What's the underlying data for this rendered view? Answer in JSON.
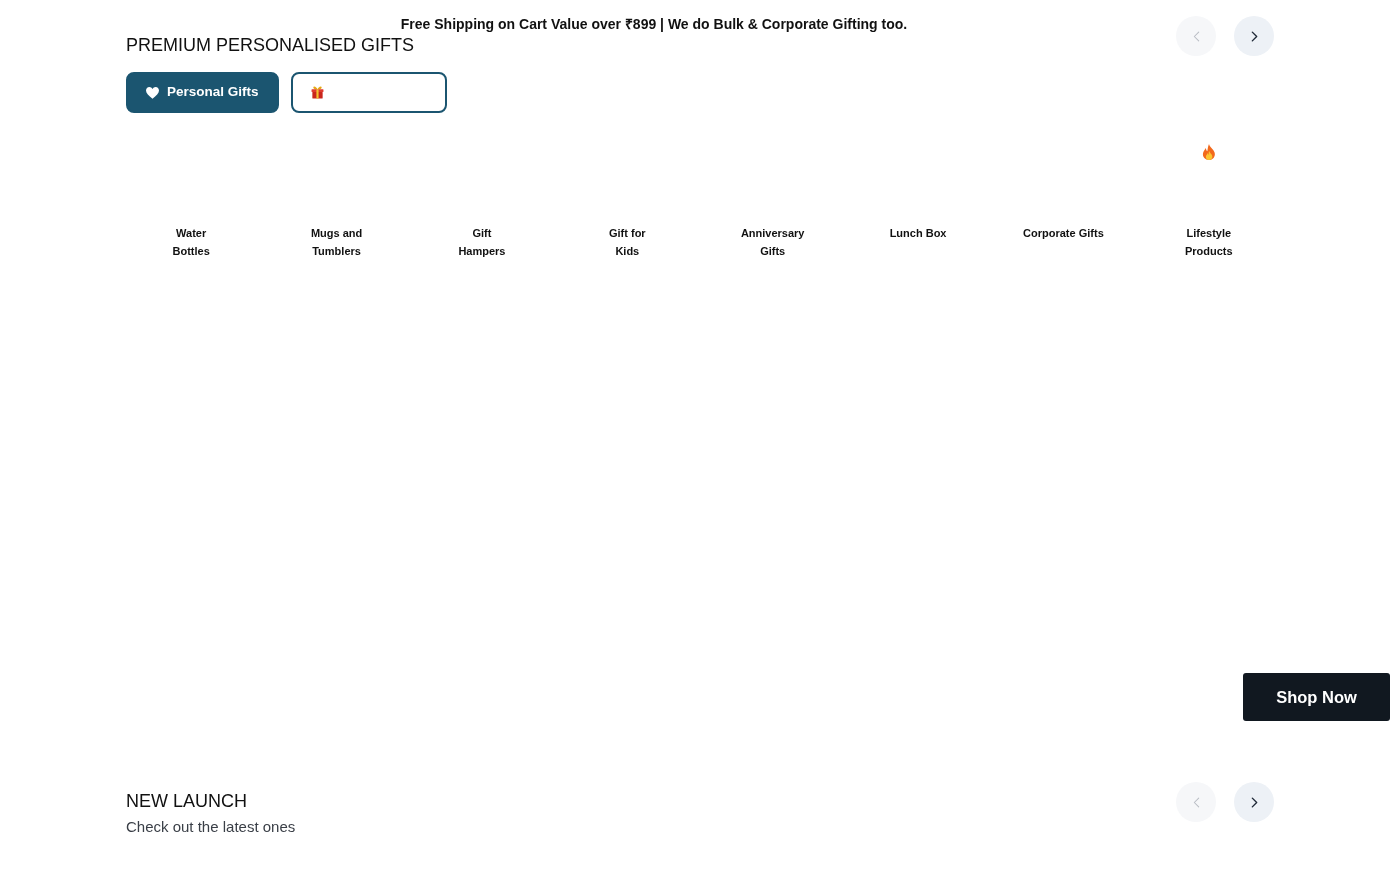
{
  "announcement": "Free Shipping on Cart Value over ₹899 | We do Bulk & Corporate Gifting too.",
  "gift_section": {
    "title": "PREMIUM PERSONALISED GIFTS",
    "carousel_buttons": [
      {
        "kind": "prev",
        "disabled": true
      },
      {
        "kind": "next",
        "disabled": false
      }
    ],
    "tabs": [
      {
        "label": "Personal Gifts",
        "selected": true
      },
      {
        "selected": false
      }
    ],
    "categories": [
      {
        "label": "Water\nBottles",
        "trending": false
      },
      {
        "label": "Mugs and\nTumblers",
        "trending": false
      },
      {
        "label": "Gift\nHampers",
        "trending": false
      },
      {
        "label": "Gift for\nKids",
        "trending": false
      },
      {
        "label": "Anniversary\nGifts",
        "trending": false
      },
      {
        "label": "Lunch Box",
        "trending": false
      },
      {
        "label": "Corporate Gifts",
        "trending": false
      },
      {
        "label": "Lifestyle\nProducts",
        "trending": true
      }
    ]
  },
  "shop_now_button": "Shop Now",
  "new_launch_section": {
    "title": "NEW LAUNCH",
    "subtitle": "Check out the latest ones",
    "carousel_buttons": [
      {
        "kind": "prev",
        "disabled": true
      },
      {
        "kind": "next",
        "disabled": false
      }
    ]
  }
}
